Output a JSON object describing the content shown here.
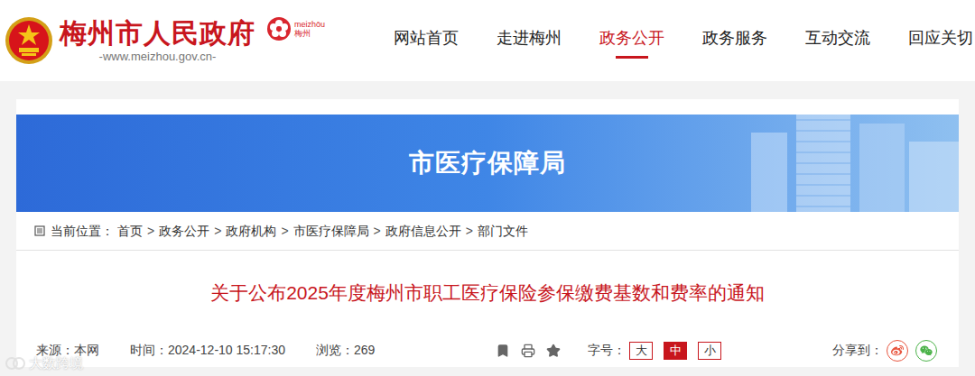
{
  "header": {
    "site_name": "梅州市人民政府",
    "url": "-www.meizhou.gov.cn-",
    "city_logo": {
      "latin": "meizhōu",
      "chinese": "梅州"
    }
  },
  "nav": [
    {
      "label": "网站首页",
      "selected": false
    },
    {
      "label": "走进梅州",
      "selected": false
    },
    {
      "label": "政务公开",
      "selected": true
    },
    {
      "label": "政务服务",
      "selected": false
    },
    {
      "label": "互动交流",
      "selected": false
    },
    {
      "label": "回应关切",
      "selected": false
    }
  ],
  "banner": {
    "title": "市医疗保障局"
  },
  "breadcrumb": {
    "label": "当前位置：",
    "separator": ">",
    "items": [
      "首页",
      "政务公开",
      "政府机构",
      "市医疗保障局",
      "政府信息公开",
      "部门文件"
    ]
  },
  "article": {
    "title": "关于公布2025年度梅州市职工医疗保险参保缴费基数和费率的通知",
    "meta": {
      "source": "来源：本网",
      "time": "时间：2024-12-10 15:17:30",
      "views": "浏览：269"
    },
    "font_size": {
      "label": "字号：",
      "options": [
        {
          "label": "大",
          "selected": false
        },
        {
          "label": "中",
          "selected": true
        },
        {
          "label": "小",
          "selected": false
        }
      ]
    },
    "share": {
      "label": "分享到："
    }
  },
  "watermark": "大数跨境"
}
